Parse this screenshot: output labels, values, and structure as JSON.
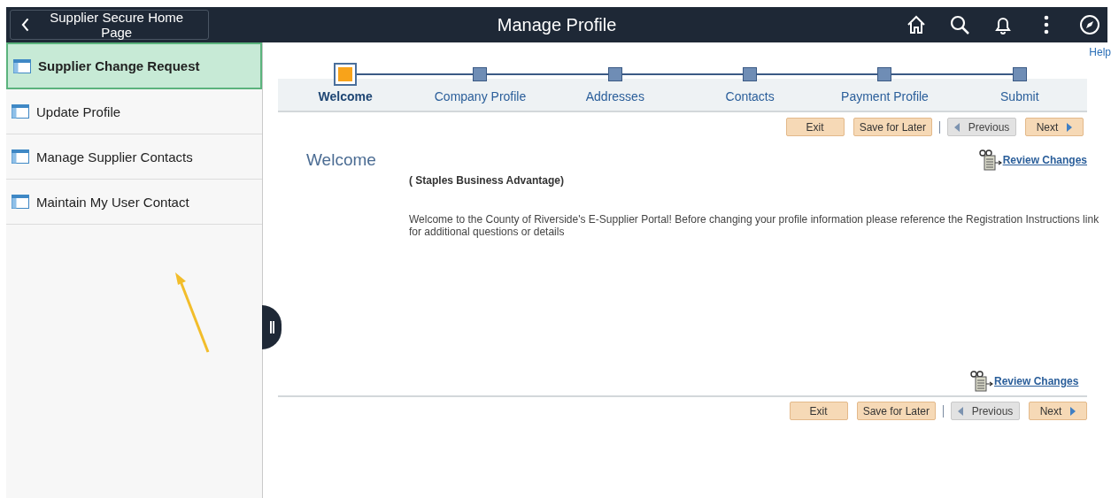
{
  "header": {
    "back_button": "Supplier Secure Home Page",
    "title": "Manage Profile"
  },
  "sidebar": {
    "items": [
      {
        "label": "Supplier Change Request",
        "selected": true
      },
      {
        "label": "Update Profile",
        "selected": false
      },
      {
        "label": "Manage Supplier Contacts",
        "selected": false
      },
      {
        "label": "Maintain My User Contact",
        "selected": false
      }
    ]
  },
  "help_link": "Help",
  "steps": [
    {
      "label": "Welcome",
      "selected": true
    },
    {
      "label": "Company Profile",
      "selected": false
    },
    {
      "label": "Addresses",
      "selected": false
    },
    {
      "label": "Contacts",
      "selected": false
    },
    {
      "label": "Payment Profile",
      "selected": false
    },
    {
      "label": "Submit",
      "selected": false
    }
  ],
  "toolbar_top": [
    {
      "label": "Exit",
      "kind": "plain",
      "disabled": false
    },
    {
      "label": "Save for Later",
      "kind": "plain",
      "disabled": false
    },
    {
      "label": "Previous",
      "kind": "previous",
      "disabled": true
    },
    {
      "label": "Next",
      "kind": "next",
      "disabled": false
    }
  ],
  "page": {
    "heading": "Welcome",
    "review_link_top": "Review Changes",
    "supplier": "( Staples Business Advantage)",
    "message": "Welcome to the County of Riverside's E-Supplier Portal! Before changing your profile information please reference the Registration Instructions link for additional questions or details",
    "review_link_bottom": "Review Changes"
  },
  "toolbar_bottom": [
    {
      "label": "Exit",
      "kind": "plain",
      "disabled": false
    },
    {
      "label": "Save for Later",
      "kind": "plain",
      "disabled": false
    },
    {
      "label": "Previous",
      "kind": "previous",
      "disabled": true
    },
    {
      "label": "Next",
      "kind": "next",
      "disabled": false
    }
  ]
}
